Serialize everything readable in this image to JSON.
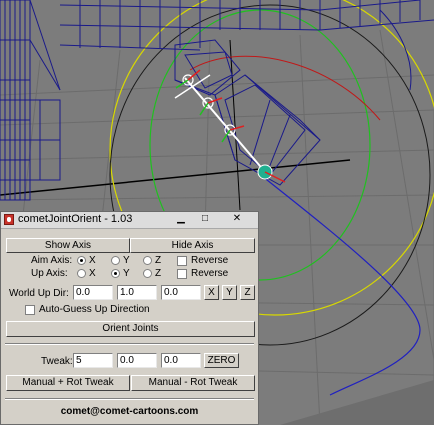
{
  "window": {
    "title": "cometJointOrient - 1.03",
    "min_glyph": "▁",
    "max_glyph": "□",
    "close_glyph": "✕"
  },
  "axis": {
    "show_label": "Show Axis",
    "hide_label": "Hide Axis"
  },
  "aim_axis": {
    "label": "Aim Axis:",
    "options": [
      "X",
      "Y",
      "Z"
    ],
    "selected": "X",
    "reverse_label": "Reverse",
    "reverse_checked": false
  },
  "up_axis": {
    "label": "Up  Axis:",
    "options": [
      "X",
      "Y",
      "Z"
    ],
    "selected": "Y",
    "reverse_label": "Reverse",
    "reverse_checked": false
  },
  "world_up": {
    "label": "World Up Dir:",
    "values": [
      "0.0",
      "1.0",
      "0.0"
    ],
    "x_label": "X",
    "y_label": "Y",
    "z_label": "Z"
  },
  "auto_guess": {
    "label": "Auto-Guess Up Direction",
    "checked": false
  },
  "orient_label": "Orient Joints",
  "tweak": {
    "label": "Tweak:",
    "values": [
      "5",
      "0.0",
      "0.0"
    ],
    "zero_label": "ZERO",
    "manual_plus_label": "Manual + Rot Tweak",
    "manual_minus_label": "Manual - Rot Tweak"
  },
  "footer_text": "comet@comet-cartoons.com",
  "colors": {
    "viewport_bg": "#7c7c7c",
    "wire": "#1a1a8a",
    "panel": "#d4d0c8"
  }
}
